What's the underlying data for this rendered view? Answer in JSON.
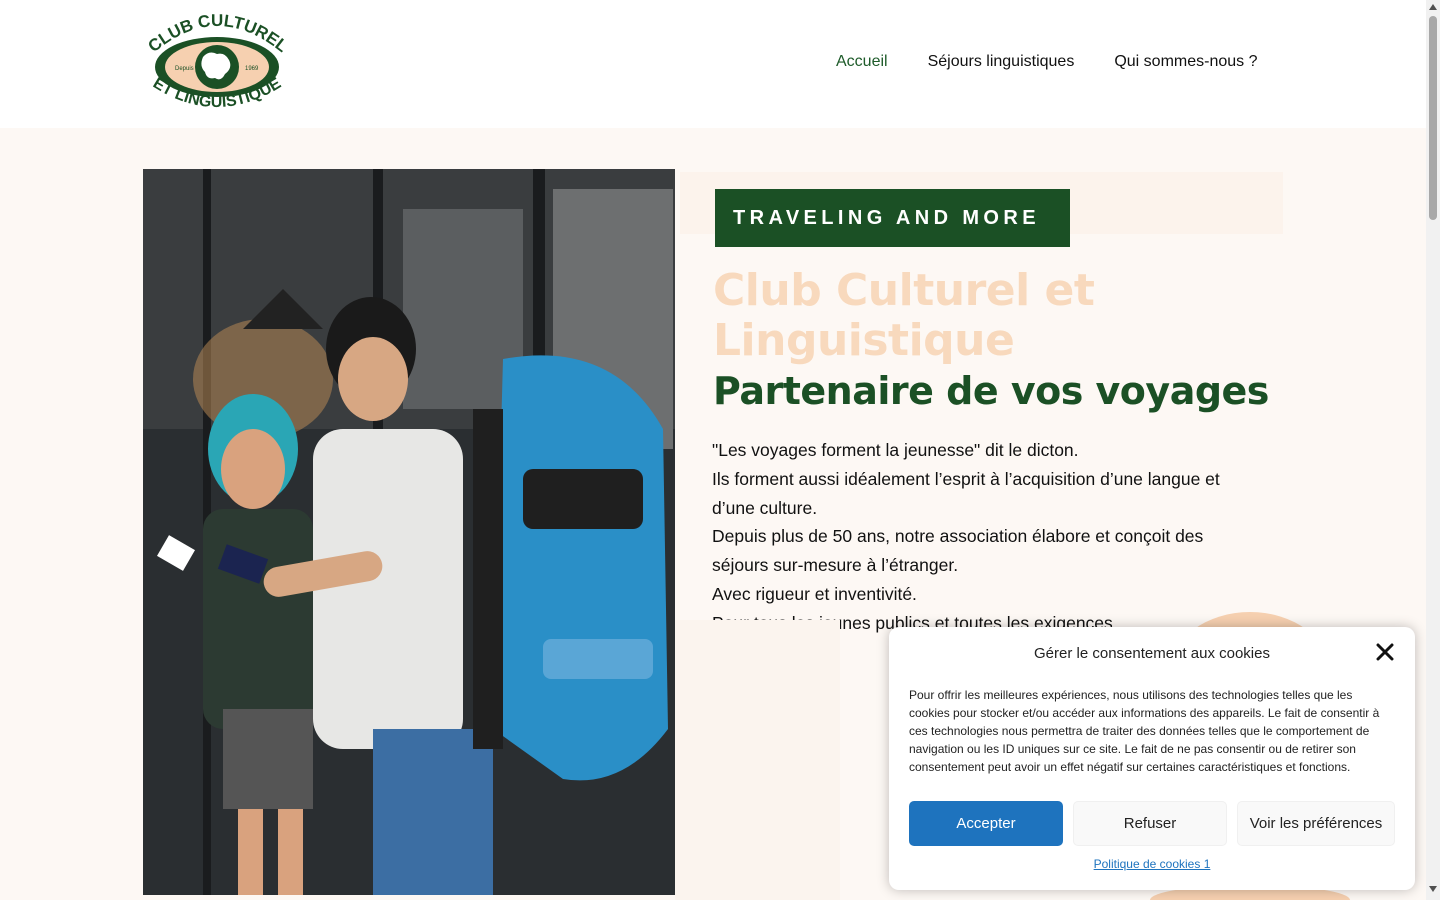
{
  "header": {
    "logo": {
      "top_text": "CLUB CULTUREL",
      "bottom_text": "ET LINGUISTIQUE",
      "left_small": "Depuis",
      "right_small": "1969",
      "colors": {
        "green": "#1b5025",
        "peach": "#f6d0b0"
      }
    },
    "nav": [
      {
        "label": "Accueil",
        "active": true
      },
      {
        "label": "Séjours linguistiques",
        "active": false
      },
      {
        "label": "Qui sommes-nous ?",
        "active": false
      }
    ]
  },
  "hero": {
    "badge": "TRAVELING AND MORE",
    "title_line1": "Club Culturel et",
    "title_line2": "Linguistique",
    "subtitle": "Partenaire de vos voyages",
    "intro": [
      "\"Les voyages forment la jeunesse\" dit le dicton.",
      "Ils forment aussi idéalement l’esprit à l’acquisition d’une langue et d’une culture.",
      "Depuis plus de 50 ans, notre association élabore et conçoit des séjours sur-mesure à l’étranger.",
      "Avec rigueur et inventivité.",
      "Pour tous les jeunes publics et toutes les exigences."
    ],
    "colors": {
      "green": "#1b5025",
      "peach_title": "#f8d9bd"
    }
  },
  "cookie": {
    "title": "Gérer le consentement aux cookies",
    "text": "Pour offrir les meilleures expériences, nous utilisons des technologies telles que les cookies pour stocker et/ou accéder aux informations des appareils. Le fait de consentir à ces technologies nous permettra de traiter des données telles que le comportement de navigation ou les ID uniques sur ce site. Le fait de ne pas consentir ou de retirer son consentement peut avoir un effet négatif sur certaines caractéristiques et fonctions.",
    "accept": "Accepter",
    "refuse": "Refuser",
    "preferences": "Voir les préférences",
    "policy_link": "Politique de cookies 1",
    "accent": "#1e73be"
  }
}
